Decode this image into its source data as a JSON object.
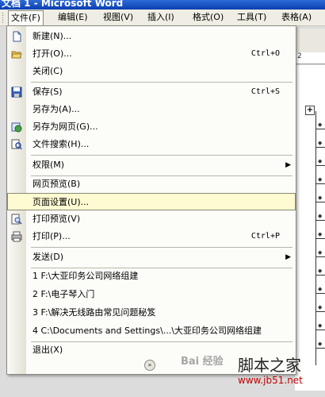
{
  "window": {
    "title": "文档 1 - Microsoft Word"
  },
  "menubar": {
    "items": [
      {
        "label": "文件(F)",
        "active": true
      },
      {
        "label": "编辑(E)",
        "active": false
      },
      {
        "label": "视图(V)",
        "active": false
      },
      {
        "label": "插入(I)",
        "active": false
      },
      {
        "label": "格式(O)",
        "active": false
      },
      {
        "label": "工具(T)",
        "active": false
      },
      {
        "label": "表格(A)",
        "active": false
      }
    ]
  },
  "file_menu": {
    "items": [
      {
        "label": "新建(N)...",
        "icon": "new-document-icon"
      },
      {
        "label": "打开(O)...",
        "shortcut": "Ctrl+O",
        "icon": "open-folder-icon"
      },
      {
        "label": "关闭(C)"
      },
      {
        "label": "保存(S)",
        "shortcut": "Ctrl+S",
        "icon": "save-disk-icon"
      },
      {
        "label": "另存为(A)..."
      },
      {
        "label": "另存为网页(G)...",
        "icon": "save-as-webpage-icon"
      },
      {
        "label": "文件搜索(H)...",
        "icon": "file-search-icon"
      },
      {
        "label": "权限(M)",
        "submenu": true
      },
      {
        "label": "网页预览(B)"
      },
      {
        "label": "页面设置(U)...",
        "highlighted": true
      },
      {
        "label": "打印预览(V)",
        "icon": "print-preview-icon"
      },
      {
        "label": "打印(P)...",
        "shortcut": "Ctrl+P",
        "icon": "printer-icon"
      },
      {
        "label": "发送(D)",
        "submenu": true
      },
      {
        "label": "1 F:\\大亚印务公司网络组建"
      },
      {
        "label": "2 F:\\电子琴入门"
      },
      {
        "label": "3 F:\\解决无线路由常见问题秘笈"
      },
      {
        "label": "4 C:\\Documents and Settings\\...\\大亚印务公司网络组建"
      },
      {
        "label": "退出(X)"
      }
    ],
    "submenu_arrow": "▶",
    "expand_glyph": "»"
  },
  "watermark": {
    "baidu": "Bai 经验",
    "site_name": "脚本之家",
    "site_url": "www.jb51.net"
  },
  "ruler_text": "2"
}
